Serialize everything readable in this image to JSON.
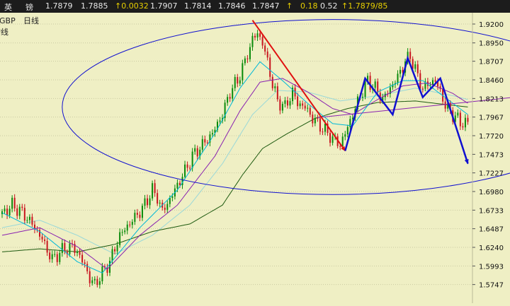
{
  "quote_bar": {
    "name_char1": "英",
    "name_char2": "镑",
    "last": "1.7879",
    "bid": "1.7885",
    "change": "↑0.0032",
    "high": "1.7907",
    "low": "1.7814",
    "open": "1.7846",
    "prev": "1.7847",
    "arrow": "↑",
    "pct": "0.18",
    "extra": "0.52",
    "bid_ask": "↑1.7879/85"
  },
  "chart_title": {
    "line1_symbol": "GBP",
    "line1_period": "日线",
    "line2": "均线"
  },
  "colors": {
    "background": "#efefc4",
    "candle_up": "#0a8a0a",
    "candle_down": "#c8141e",
    "ma_fast": "#00b8d8",
    "ma_mid": "#8a22b0",
    "ma_slow": "#1e5a10",
    "ma_light": "#9ad8d8",
    "red_annotation": "#e01010",
    "blue_annotation": "#1010d0"
  },
  "chart_data": {
    "type": "candlestick",
    "ylim": [
      1.55,
      1.935
    ],
    "y_ticks": [
      "1.9200",
      "1.8950",
      "1.8707",
      "1.8460",
      "1.8213",
      "1.7967",
      "1.7720",
      "1.7473",
      "1.7227",
      "1.6980",
      "1.6733",
      "1.6487",
      "1.6240",
      "1.5993",
      "1.5747"
    ],
    "y_tick_values": [
      1.92,
      1.895,
      1.8707,
      1.846,
      1.8213,
      1.7967,
      1.772,
      1.7473,
      1.7227,
      1.698,
      1.6733,
      1.6487,
      1.624,
      1.5993,
      1.5747
    ],
    "grid": true,
    "close_path": [
      [
        0,
        1.668
      ],
      [
        4,
        1.68
      ],
      [
        8,
        1.67
      ],
      [
        12,
        1.655
      ],
      [
        16,
        1.635
      ],
      [
        18,
        1.62
      ],
      [
        20,
        1.608
      ],
      [
        24,
        1.62
      ],
      [
        28,
        1.625
      ],
      [
        30,
        1.618
      ],
      [
        33,
        1.6
      ],
      [
        35,
        1.582
      ],
      [
        37,
        1.575
      ],
      [
        40,
        1.59
      ],
      [
        43,
        1.605
      ],
      [
        47,
        1.64
      ],
      [
        52,
        1.66
      ],
      [
        56,
        1.675
      ],
      [
        60,
        1.7
      ],
      [
        62,
        1.69
      ],
      [
        64,
        1.672
      ],
      [
        66,
        1.682
      ],
      [
        69,
        1.7
      ],
      [
        73,
        1.725
      ],
      [
        76,
        1.745
      ],
      [
        80,
        1.76
      ],
      [
        84,
        1.775
      ],
      [
        88,
        1.8
      ],
      [
        91,
        1.83
      ],
      [
        94,
        1.845
      ],
      [
        97,
        1.87
      ],
      [
        100,
        1.9
      ],
      [
        102,
        1.908
      ],
      [
        104,
        1.895
      ],
      [
        106,
        1.87
      ],
      [
        108,
        1.84
      ],
      [
        110,
        1.818
      ],
      [
        113,
        1.81
      ],
      [
        116,
        1.83
      ],
      [
        118,
        1.815
      ],
      [
        121,
        1.81
      ],
      [
        124,
        1.795
      ],
      [
        127,
        1.785
      ],
      [
        130,
        1.775
      ],
      [
        133,
        1.765
      ],
      [
        135,
        1.76
      ],
      [
        137,
        1.775
      ],
      [
        140,
        1.8
      ],
      [
        143,
        1.825
      ],
      [
        146,
        1.845
      ],
      [
        149,
        1.835
      ],
      [
        152,
        1.82
      ],
      [
        155,
        1.835
      ],
      [
        158,
        1.85
      ],
      [
        161,
        1.87
      ],
      [
        163,
        1.878
      ],
      [
        166,
        1.85
      ],
      [
        168,
        1.835
      ],
      [
        170,
        1.84
      ],
      [
        173,
        1.845
      ],
      [
        175,
        1.83
      ],
      [
        177,
        1.812
      ],
      [
        180,
        1.8
      ],
      [
        183,
        1.79
      ],
      [
        186,
        1.788
      ]
    ],
    "moving_averages": [
      {
        "key": "ma_fast",
        "points": [
          [
            0,
            1.67
          ],
          [
            15,
            1.645
          ],
          [
            30,
            1.605
          ],
          [
            40,
            1.59
          ],
          [
            55,
            1.65
          ],
          [
            70,
            1.7
          ],
          [
            85,
            1.775
          ],
          [
            95,
            1.835
          ],
          [
            103,
            1.87
          ],
          [
            112,
            1.845
          ],
          [
            122,
            1.815
          ],
          [
            132,
            1.788
          ],
          [
            140,
            1.785
          ],
          [
            150,
            1.83
          ],
          [
            160,
            1.845
          ],
          [
            168,
            1.845
          ],
          [
            178,
            1.82
          ],
          [
            186,
            1.8
          ]
        ]
      },
      {
        "key": "ma_mid",
        "points": [
          [
            0,
            1.64
          ],
          [
            15,
            1.65
          ],
          [
            30,
            1.625
          ],
          [
            42,
            1.595
          ],
          [
            55,
            1.64
          ],
          [
            70,
            1.68
          ],
          [
            85,
            1.745
          ],
          [
            95,
            1.805
          ],
          [
            103,
            1.843
          ],
          [
            112,
            1.848
          ],
          [
            122,
            1.83
          ],
          [
            132,
            1.808
          ],
          [
            140,
            1.8
          ],
          [
            150,
            1.82
          ],
          [
            160,
            1.838
          ],
          [
            170,
            1.842
          ],
          [
            180,
            1.828
          ],
          [
            186,
            1.815
          ]
        ]
      },
      {
        "key": "ma_light",
        "points": [
          [
            0,
            1.65
          ],
          [
            15,
            1.66
          ],
          [
            30,
            1.64
          ],
          [
            45,
            1.615
          ],
          [
            60,
            1.64
          ],
          [
            75,
            1.68
          ],
          [
            88,
            1.735
          ],
          [
            100,
            1.8
          ],
          [
            110,
            1.832
          ],
          [
            122,
            1.83
          ],
          [
            135,
            1.818
          ],
          [
            150,
            1.825
          ],
          [
            165,
            1.835
          ],
          [
            180,
            1.825
          ],
          [
            186,
            1.82
          ]
        ]
      },
      {
        "key": "ma_slow",
        "points": [
          [
            0,
            1.618
          ],
          [
            15,
            1.622
          ],
          [
            30,
            1.618
          ],
          [
            45,
            1.628
          ],
          [
            60,
            1.645
          ],
          [
            75,
            1.655
          ],
          [
            88,
            1.68
          ],
          [
            96,
            1.72
          ],
          [
            104,
            1.755
          ],
          [
            114,
            1.775
          ],
          [
            125,
            1.795
          ],
          [
            138,
            1.808
          ],
          [
            150,
            1.816
          ],
          [
            165,
            1.818
          ],
          [
            178,
            1.813
          ],
          [
            186,
            1.81
          ]
        ]
      }
    ],
    "annotations": {
      "red_arrow": [
        [
          100,
          1.925
        ],
        [
          137,
          1.752
        ]
      ],
      "blue_zigzag": [
        [
          137,
          1.752
        ],
        [
          145,
          1.848
        ],
        [
          156,
          1.8
        ],
        [
          162,
          1.875
        ],
        [
          168,
          1.823
        ],
        [
          175,
          1.848
        ],
        [
          186,
          1.735
        ]
      ],
      "purple_line": [
        [
          126,
          1.796
        ],
        [
          190,
          1.823
        ]
      ],
      "ellipse_center": [
        132,
        1.81
      ],
      "ellipse_rx": 108,
      "ellipse_ry_price": 0.116
    }
  }
}
